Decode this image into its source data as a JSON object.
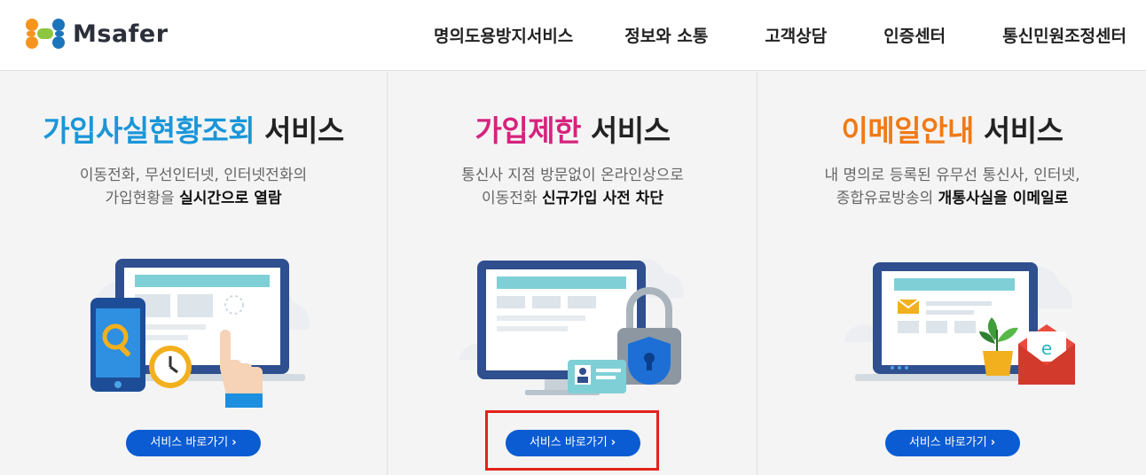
{
  "brand": {
    "name": "Msafer"
  },
  "nav": [
    "명의도용방지서비스",
    "정보와 소통",
    "고객상담",
    "인증센터",
    "통신민원조정센터"
  ],
  "panels": [
    {
      "title_accent": "가입사실현황조회",
      "title_rest": " 서비스",
      "accent_color": "#1a96d8",
      "desc_line1": "이동전화, 무선인터넷, 인터넷전화의",
      "desc_line2_plain": "가입현황을 ",
      "desc_line2_bold": "실시간으로 열람",
      "button": "서비스 바로가기"
    },
    {
      "title_accent": "가입제한",
      "title_rest": " 서비스",
      "accent_color": "#d6237d",
      "desc_line1": "통신사 지점 방문없이 온라인상으로",
      "desc_line2_plain": "이동전화 ",
      "desc_line2_bold": "신규가입 사전 차단",
      "button": "서비스 바로가기"
    },
    {
      "title_accent": "이메일안내",
      "title_rest": " 서비스",
      "accent_color": "#f07a16",
      "desc_line1": "내 명의로 등록된 유무선 통신사, 인터넷,",
      "desc_line2_plain": "종합유료방송의 ",
      "desc_line2_bold": "개통사실을 이메일로",
      "button": "서비스 바로가기"
    }
  ],
  "icons": {
    "button_chevron": "chevron-right-icon",
    "illus1": "phone-search-clock-monitor-illustration",
    "illus2": "monitor-lock-id-illustration",
    "illus3": "monitor-mail-plant-illustration"
  },
  "colors": {
    "button": "#0b5cd3",
    "highlight": "#e2231a"
  }
}
